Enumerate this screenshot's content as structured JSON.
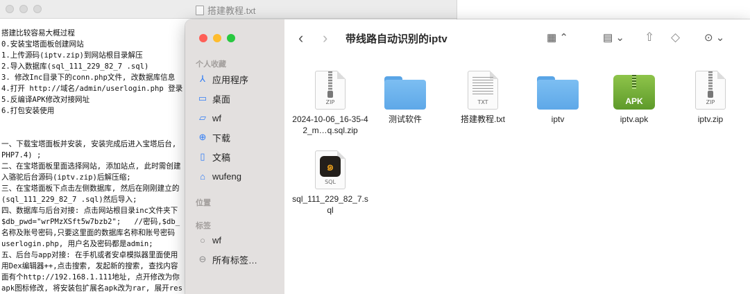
{
  "textedit": {
    "title": "搭建教程.txt",
    "lines": [
      "搭建比较容易大概过程",
      "0.安装宝塔面板创建网站",
      "1.上传源码(iptv.zip)到网站根目录解压",
      "2.导入数据库(sql_111_229_82_7 .sql)",
      "3. 修改Inc目录下的conn.php文件, 改数据库信息",
      "4.打开 http://域名/admin/userlogin.php 登录",
      "5.反编译APK修改对接网址",
      "6.打包安装使用",
      "",
      "",
      "一、下载宝塔面板并安装, 安装完成后进入宝塔后台,",
      "PHP7.4) ;",
      "二、在宝塔面板里面选择网站, 添加站点, 此时需创建",
      "入骆驼后台源码(iptv.zip)后解压缩;",
      "三、在宝塔面板下点击左侧数据库, 然后在刚刚建立的",
      "(sql_111_229_82_7 .sql)然后导入;",
      "四、数据库与后台对接: 点击网站根目录inc文件夹下",
      "$db_pwd=\"wrPMzXSft5w7bzb2\";   //密码,$db_",
      "名称及账号密码,只要这里面的数据库名称和账号密码",
      "userlogin.php, 用户名及密码都是admin;",
      "五、后台与app对接: 在手机或者安卓模拟器里面使用",
      "用Dex编辑器++,点击搜索, 发起新的搜索, 查找内容",
      "面有个http://192.168.1.111地址, 点开修改为你",
      "apk图标修改, 将安装包扩展名apk改为rar, 展开res"
    ]
  },
  "finder": {
    "folder_title": "带线路自动识别的iptv",
    "sidebar": {
      "favorites_header": "个人收藏",
      "favorites": [
        {
          "label": "应用程序",
          "icon": "applications-icon",
          "glyph": "⅄"
        },
        {
          "label": "桌面",
          "icon": "desktop-icon",
          "glyph": "▭"
        },
        {
          "label": "wf",
          "icon": "folder-icon",
          "glyph": "▱"
        },
        {
          "label": "下载",
          "icon": "download-icon",
          "glyph": "⊕"
        },
        {
          "label": "文稿",
          "icon": "document-icon",
          "glyph": "▯"
        },
        {
          "label": "wufeng",
          "icon": "home-icon",
          "glyph": "⌂"
        }
      ],
      "locations_header": "位置",
      "tags_header": "标签",
      "tags": [
        {
          "label": "wf",
          "icon": "tag-circle-icon",
          "glyph": "○"
        },
        {
          "label": "所有标签…",
          "icon": "all-tags-icon",
          "glyph": "⊖"
        }
      ]
    },
    "toolbar": {
      "back": "‹",
      "forward": "›",
      "view_grid": "▦ ⌃",
      "group": "▤ ⌄",
      "share": "⇧",
      "tag": "◇",
      "more": "⊙ ⌄"
    },
    "files": [
      {
        "name": "2024-10-06_16-35-42_m…q.sql.zip",
        "kind": "zip",
        "ext": "ZIP"
      },
      {
        "name": "测试软件",
        "kind": "folder",
        "ext": ""
      },
      {
        "name": "搭建教程.txt",
        "kind": "txt",
        "ext": "TXT"
      },
      {
        "name": "iptv",
        "kind": "folder",
        "ext": ""
      },
      {
        "name": "iptv.apk",
        "kind": "apk",
        "ext": "APK"
      },
      {
        "name": "iptv.zip",
        "kind": "zip",
        "ext": "ZIP"
      },
      {
        "name": "sql_111_229_82_7.sql",
        "kind": "sql",
        "ext": "SQL"
      }
    ]
  },
  "colors": {
    "accent": "#2f7cf6",
    "close": "#fe5f57",
    "minimize": "#febc2e",
    "zoom": "#28c840"
  }
}
